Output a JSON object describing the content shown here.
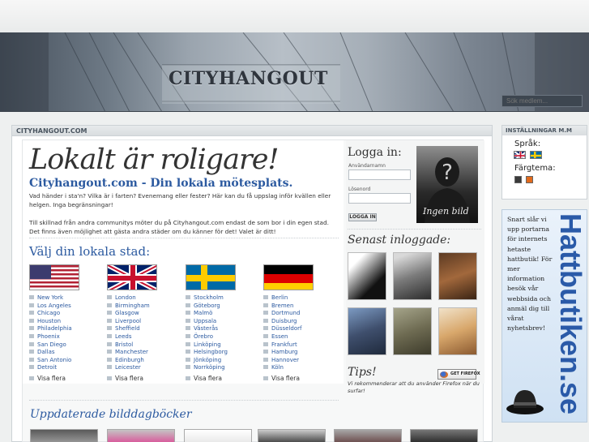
{
  "banner": {
    "title": "CITYHANGOUT",
    "search_placeholder": "Sök medlem..."
  },
  "main": {
    "section_header": "CITYHANGOUT.COM",
    "hero": "Lokalt är roligare!",
    "subtitle": "Cityhangout.com - Din lokala mötesplats.",
    "intro": [
      "Vad händer i sta'n? Vilka är i farten? Evenemang eller fester? Här kan du få uppslag inför kvällen eller helgen. Inga begränsningar!",
      "Till skillnad från andra communitys möter du på Cityhangout.com endast de som bor i din egen stad. Det finns även möjlighet att gästa andra städer om du känner för det! Valet är ditt!"
    ],
    "choose_city": "Välj din lokala stad:",
    "countries": [
      {
        "flag": "usa-flag",
        "cities": [
          "New York",
          "Los Angeles",
          "Chicago",
          "Houston",
          "Philadelphia",
          "Phoenix",
          "San Diego",
          "Dallas",
          "San Antonio",
          "Detroit"
        ],
        "more": "Visa flera"
      },
      {
        "flag": "uk-flag",
        "cities": [
          "London",
          "Birmingham",
          "Glasgow",
          "Liverpool",
          "Sheffield",
          "Leeds",
          "Bristol",
          "Manchester",
          "Edinburgh",
          "Leicester"
        ],
        "more": "Visa flera"
      },
      {
        "flag": "sweden-flag",
        "cities": [
          "Stockholm",
          "Göteborg",
          "Malmö",
          "Uppsala",
          "Västerås",
          "Örebro",
          "Linköping",
          "Helsingborg",
          "Jönköping",
          "Norrköping"
        ],
        "more": "Visa flera"
      },
      {
        "flag": "germany-flag",
        "cities": [
          "Berlin",
          "Bremen",
          "Dortmund",
          "Duisburg",
          "Düsseldorf",
          "Essen",
          "Frankfurt",
          "Hamburg",
          "Hannover",
          "Köln"
        ],
        "more": "Visa flera"
      }
    ],
    "diaries_header": "Uppdaterade bilddagböcker"
  },
  "login": {
    "title": "Logga in:",
    "username_label": "Användarnamn",
    "password_label": "Lösenord",
    "button": "LOGGA IN",
    "avatar_caption": "Ingen bild"
  },
  "latest": {
    "title": "Senast inloggade:"
  },
  "tips": {
    "title": "Tips!",
    "firefox_button": "GET FIREFOX",
    "text": "Vi rekommenderar att du använder Firefox när du surfar!"
  },
  "settings": {
    "header": "INSTÄLLNINGAR M.M",
    "language_label": "Språk:",
    "color_label": "Färgtema:",
    "colors": [
      "#3a3a3a",
      "#e26a1b"
    ]
  },
  "ad": {
    "text": "Snart slår vi upp portarna för internets hetaste hattbutik! För mer information besök vår webbsida och anmäl dig till vårat nyhetsbrev!",
    "logo": "Hattbutiken.se"
  }
}
